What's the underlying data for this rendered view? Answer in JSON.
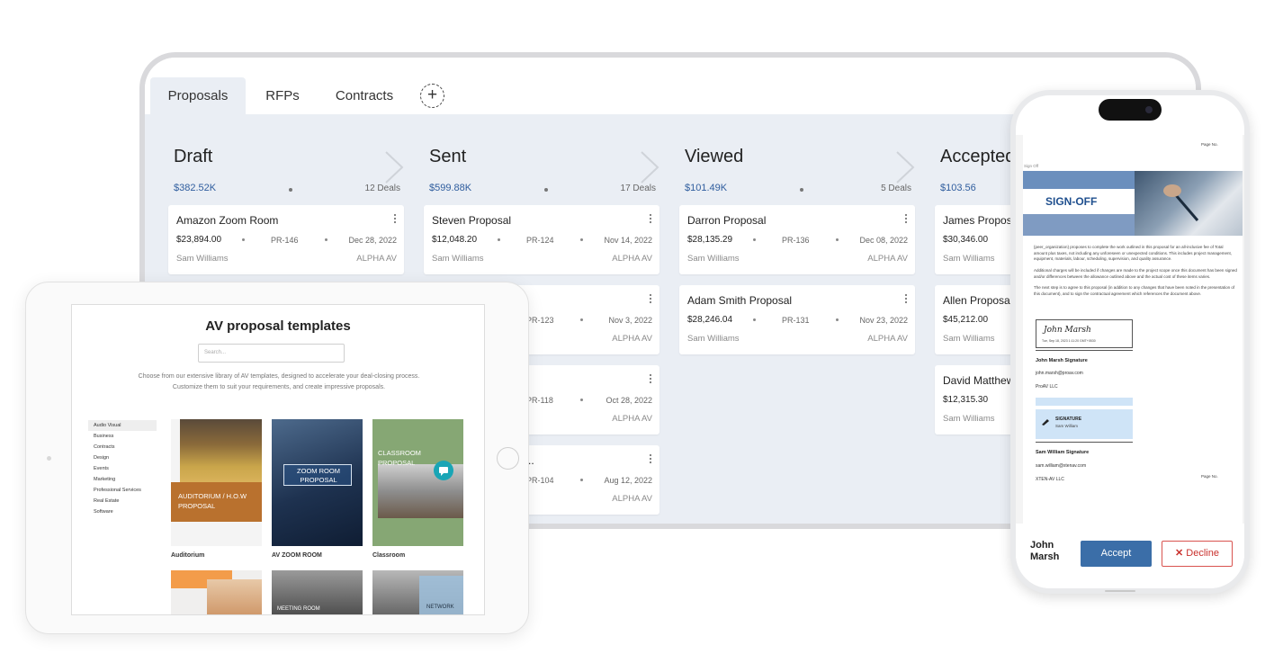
{
  "tabs": [
    {
      "label": "Proposals",
      "active": true
    },
    {
      "label": "RFPs",
      "active": false
    },
    {
      "label": "Contracts",
      "active": false
    }
  ],
  "columns": [
    {
      "title": "Draft",
      "amount": "$382.52K",
      "deals": "12 Deals",
      "cards": [
        {
          "title": "Amazon Zoom Room",
          "amount": "$23,894.00",
          "pr": "PR-146",
          "date": "Dec 28, 2022",
          "owner": "Sam Williams",
          "company": "ALPHA AV"
        }
      ]
    },
    {
      "title": "Sent",
      "amount": "$599.88K",
      "deals": "17 Deals",
      "cards": [
        {
          "title": "Steven Proposal",
          "amount": "$12,048.20",
          "pr": "PR-124",
          "date": "Nov 14, 2022",
          "owner": "Sam Williams",
          "company": "ALPHA AV"
        },
        {
          "title": "",
          "amount": "",
          "pr": "PR-123",
          "date": "Nov 3, 2022",
          "owner": "",
          "company": "ALPHA AV"
        },
        {
          "title": "",
          "amount": "",
          "pr": "PR-118",
          "date": "Oct 28, 2022",
          "owner": "",
          "company": "ALPHA AV"
        },
        {
          "title": "..",
          "amount": "",
          "pr": "PR-104",
          "date": "Aug 12, 2022",
          "owner": "",
          "company": "ALPHA AV"
        }
      ]
    },
    {
      "title": "Viewed",
      "amount": "$101.49K",
      "deals": "5 Deals",
      "cards": [
        {
          "title": "Darron Proposal",
          "amount": "$28,135.29",
          "pr": "PR-136",
          "date": "Dec 08, 2022",
          "owner": "Sam Williams",
          "company": "ALPHA AV"
        },
        {
          "title": "Adam Smith Proposal",
          "amount": "$28,246.04",
          "pr": "PR-131",
          "date": "Nov 23, 2022",
          "owner": "Sam Williams",
          "company": "ALPHA AV"
        }
      ]
    },
    {
      "title": "Accepted",
      "amount": "$103.56",
      "deals": "",
      "cards": [
        {
          "title": "James Proposal",
          "amount": "$30,346.00",
          "pr": "",
          "date": "",
          "owner": "Sam Williams",
          "company": ""
        },
        {
          "title": "Allen Proposal",
          "amount": "$45,212.00",
          "pr": "",
          "date": "",
          "owner": "Sam Williams",
          "company": ""
        },
        {
          "title": "David Matthews",
          "amount": "$12,315.30",
          "pr": "",
          "date": "",
          "owner": "Sam Williams",
          "company": ""
        }
      ]
    }
  ],
  "tablet": {
    "title": "AV proposal templates",
    "search_placeholder": "Search...",
    "description": "Choose from our extensive library of AV templates, designed to accelerate your deal-closing process. Customize them to suit your requirements, and create impressive proposals.",
    "categories": [
      "Audio Visual",
      "Business",
      "Contracts",
      "Design",
      "Events",
      "Marketing",
      "Professional Services",
      "Real Estate",
      "Software"
    ],
    "selected_category": "Audio Visual",
    "templates": [
      {
        "label": "Auditorium",
        "overlay": "AUDITORIUM / H.O.W PROPOSAL"
      },
      {
        "label": "AV ZOOM ROOM",
        "overlay": "ZOOM ROOM PROPOSAL"
      },
      {
        "label": "Classroom",
        "overlay": "CLASSROOM PROPOSAL"
      }
    ],
    "row2": [
      {
        "overlay": ""
      },
      {
        "overlay": "MEETING ROOM"
      },
      {
        "overlay": "NETWORK"
      }
    ]
  },
  "phone": {
    "page_no": "Page No.",
    "sign_off_small": "Sign Off",
    "sign_off_banner": "SIGN-OFF",
    "para1": "{peer_organization} proposes to complete the work outlined in this proposal for an all-inclusive fee of Total amount plus taxes, not including any unforeseen or unexpected conditions. This includes project management, equipment, materials, labour, scheduling, supervision, and quality assurance.",
    "para2": "Additional charges will be included if changes are made to the project scope once this document has been signed and/or differences between the allowance outlined above and the actual cost of these items varies.",
    "para3": "The next step is to agree to this proposal (in addition to any changes that have been noted in the presentation of this document), and to sign the contractual agreement which references the document above.",
    "sig1_script": "John Marsh",
    "sig1_date": "Tue, Sep 18, 2023 1:11:20 GMT+0530",
    "sig1_title": "John Marsh Signature",
    "sig1_email": "john.marsh@proav.com",
    "sig1_company": "ProAV LLC",
    "sig2_label": "SIGNATURE",
    "sig2_name": "Sam William",
    "sig2_title": "Sam William Signature",
    "sig2_email": "sam.william@xtenav.com",
    "sig2_company": "XTEN-AV LLC",
    "signer_name": "John Marsh",
    "accept_label": "Accept",
    "decline_label": "Decline"
  },
  "colors": {
    "board_bg": "#eaeef4",
    "accent_blue": "#3b6ea8",
    "amount_blue": "#2f5d9e",
    "decline_red": "#c9302c"
  }
}
